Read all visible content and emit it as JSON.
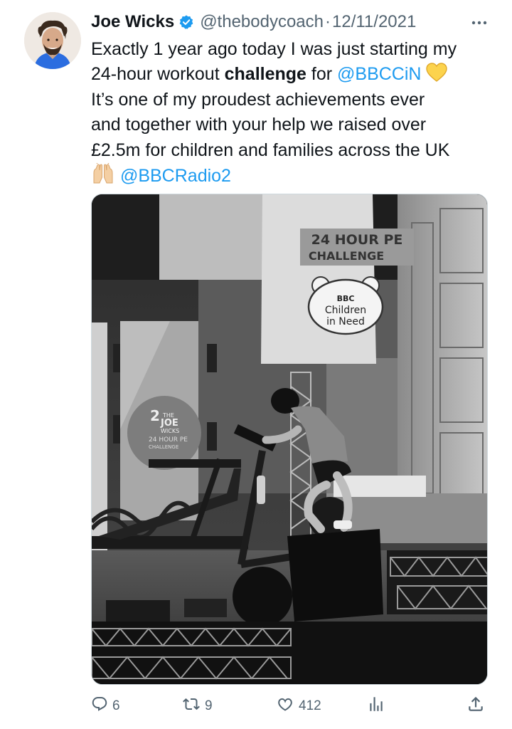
{
  "author": {
    "display_name": "Joe Wicks",
    "handle": "@thebodycoach",
    "separator": "·",
    "date": "12/11/2021",
    "verified_color": "#1d9bf0"
  },
  "tweet": {
    "lines": [
      [
        {
          "t": "Exactly 1 year ago today I was just starting my"
        }
      ],
      [
        {
          "t": "24-hour workout "
        },
        {
          "b": "challenge"
        },
        {
          "t": " for "
        },
        {
          "m": "@BBCCiN"
        }
      ],
      [
        {
          "t": "It’s one of my proudest achievements ever"
        }
      ],
      [
        {
          "t": "and together with your help we raised over"
        }
      ],
      [
        {
          "t": "£2.5m for children and families across the UK"
        }
      ],
      [
        {
          "m": "@BBCRadio2"
        }
      ]
    ],
    "line1": "Exactly 1 year ago today I was just starting my",
    "line2_a": "24-hour workout ",
    "line2_bold": "challenge",
    "line2_b": " for ",
    "mention1": "@BBCCiN",
    "line3": "It’s one of my proudest achievements ever",
    "line4": "and together with your help we raised over",
    "line5": "£2.5m for children and families across the UK",
    "mention2": "@BBCRadio2",
    "emoji_heart": "yellow-heart",
    "emoji_hands": "raising-hands",
    "mention_color": "#1d9bf0"
  },
  "media": {
    "sign_title_1": "24 HOUR PE",
    "sign_title_2": "CHALLENGE",
    "badge_1": "BBC",
    "badge_2": "Children",
    "badge_3": "in Need",
    "poster_1": "THE",
    "poster_2": "JOE",
    "poster_3": "WICKS",
    "poster_4": "24 HOUR PE",
    "poster_5": "CHALLENGE",
    "poster_num": "2"
  },
  "actions": {
    "replies": "6",
    "retweets": "9",
    "likes": "412",
    "reply_icon": "reply-icon",
    "retweet_icon": "retweet-icon",
    "like_icon": "heart-icon",
    "views_icon": "analytics-icon",
    "share_icon": "share-icon"
  }
}
